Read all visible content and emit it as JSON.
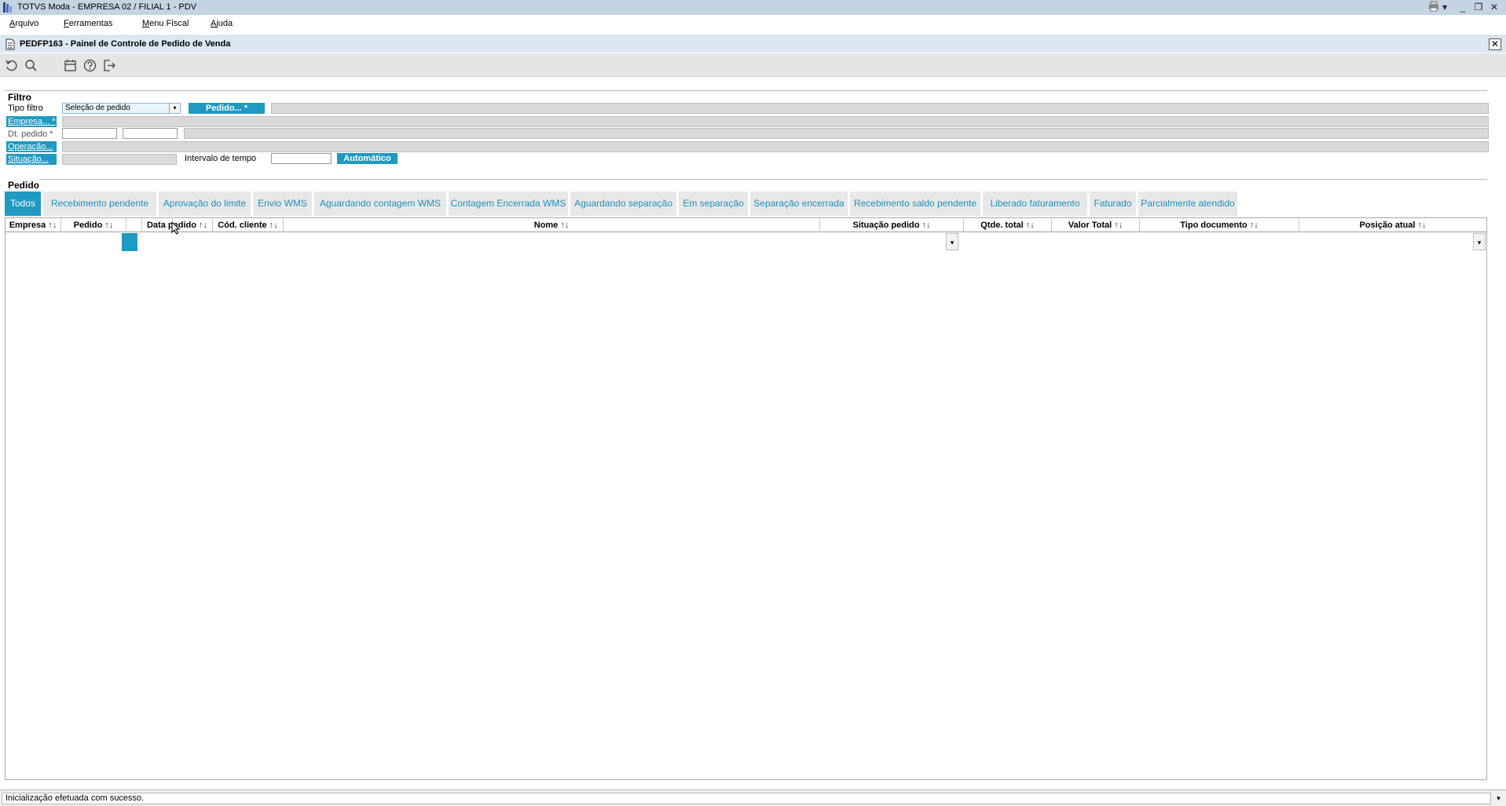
{
  "window": {
    "title": "TOTVS Moda - EMPRESA 02 / FILIAL 1 - PDV"
  },
  "menu": {
    "items": [
      {
        "first": "A",
        "rest": "rquivo"
      },
      {
        "first": "F",
        "rest": "erramentas"
      },
      {
        "first": "M",
        "rest": "enu Fiscal"
      },
      {
        "first": "A",
        "rest": "juda"
      }
    ]
  },
  "form": {
    "title": "PEDFP163 - Painel de Controle de Pedido de Venda",
    "close_glyph": "✕"
  },
  "toolbar": {
    "icons": [
      "refresh-icon",
      "search-icon",
      "calendar-icon",
      "help-icon",
      "exit-icon"
    ]
  },
  "filter": {
    "section_title": "Filtro",
    "tipo_filtro_label": "Tipo filtro",
    "tipo_filtro_value": "Seleção de pedido",
    "pedido_button": "Pedido... *",
    "empresa_label": "Empresa... *",
    "dt_pedido_label": "Dt. pedido *",
    "operacao_label": "Operação...",
    "situacao_label": "Situação...",
    "intervalo_label": "Intervalo de tempo",
    "automatico_button": "Automático"
  },
  "pedido": {
    "section_title": "Pedido",
    "tabs": [
      "Todos",
      "Recebimento pendente",
      "Aprovação do limite",
      "Envio WMS",
      "Aguardando contagem WMS",
      "Contagem Encerrada WMS",
      "Aguardando separação",
      "Em separação",
      "Separação encerrada",
      "Recebimento saldo pendente",
      "Liberado faturamento",
      "Faturado",
      "Parcialmente atendido"
    ],
    "active_tab": "Todos",
    "columns": [
      "Empresa",
      "Pedido",
      "",
      "Data pedido",
      "Cód. cliente",
      "Nome",
      "Situação pedido",
      "Qtde. total",
      "Valor Total",
      "Tipo documento",
      "Posição atual"
    ],
    "sort_glyph": "↑↓"
  },
  "status": {
    "message": "Inicialização efetuada com sucesso."
  },
  "colors": {
    "accent": "#1f9ac2",
    "titlebar": "#c3d4e3",
    "formbar": "#dde7f1"
  }
}
